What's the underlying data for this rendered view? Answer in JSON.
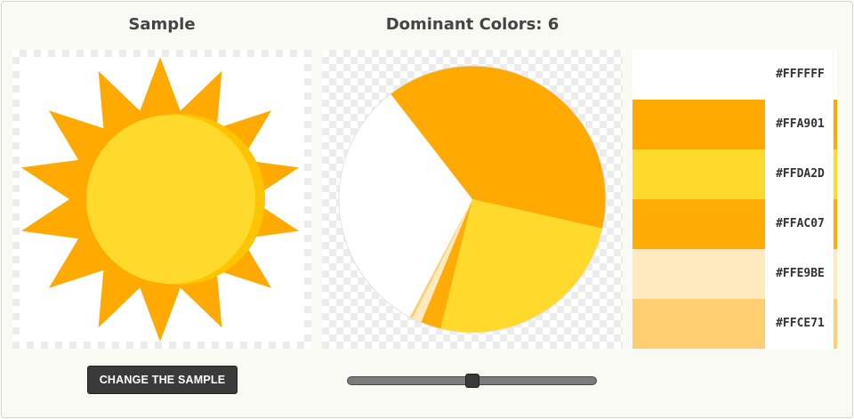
{
  "sample": {
    "title": "Sample"
  },
  "dominant": {
    "title": "Dominant Colors: 6"
  },
  "palette": [
    {
      "hex": "#FFFFFF",
      "color": "#FFFFFF",
      "share": 0.257
    },
    {
      "hex": "#FFA901",
      "color": "#FFA901",
      "share": 0.316
    },
    {
      "hex": "#FFDA2D",
      "color": "#FFDA2D",
      "share": 0.205
    },
    {
      "hex": "#FFAC07",
      "color": "#FFAC07",
      "share": 0.02
    },
    {
      "hex": "#FFE9BE",
      "color": "#FFE9BE",
      "share": 0.009
    },
    {
      "hex": "#FFCE71",
      "color": "#FFCE71",
      "share": 0.003
    }
  ],
  "controls": {
    "change_sample_label": "CHANGE THE SAMPLE",
    "slider_value": 0.5
  },
  "icons": {
    "sample_image": "sun-icon"
  }
}
